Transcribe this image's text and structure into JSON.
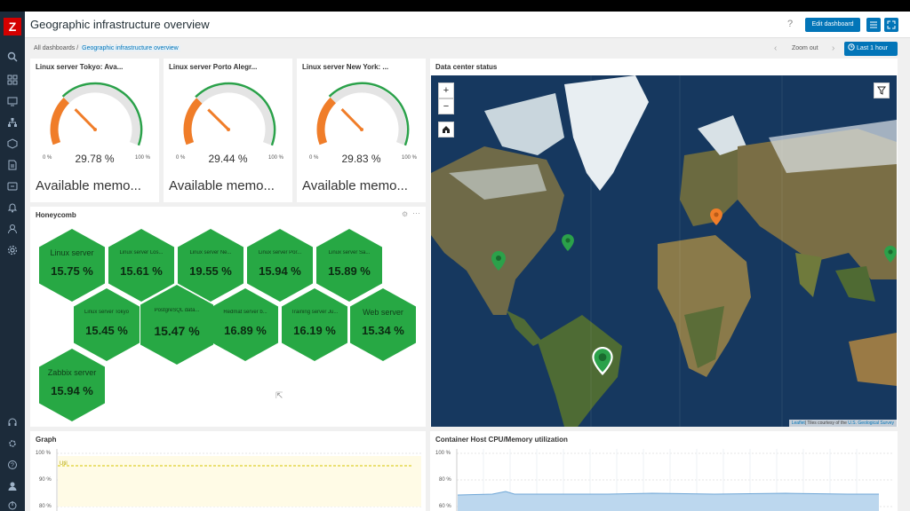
{
  "header": {
    "title": "Geographic infrastructure overview",
    "help": "?",
    "edit_label": "Edit dashboard"
  },
  "breadcrumb": {
    "root": "All dashboards",
    "separator": "/",
    "current": "Geographic infrastructure overview"
  },
  "time_controls": {
    "zoom_out": "Zoom out",
    "range": "Last 1 hour"
  },
  "gauges": [
    {
      "title": "Linux server Tokyo: Ava...",
      "value": "29.78 %",
      "fraction": 0.2978,
      "min": "0 %",
      "max": "100 %",
      "desc": "Available memo..."
    },
    {
      "title": "Linux server Porto Alegr...",
      "value": "29.44 %",
      "fraction": 0.2944,
      "min": "0 %",
      "max": "100 %",
      "desc": "Available memo..."
    },
    {
      "title": "Linux server New York: ...",
      "value": "29.83 %",
      "fraction": 0.2983,
      "min": "0 %",
      "max": "100 %",
      "desc": "Available memo..."
    }
  ],
  "honeycomb": {
    "title": "Honeycomb",
    "cells": [
      {
        "name": "Linux server",
        "value": "15.75 %"
      },
      {
        "name": "Linux server Los...",
        "value": "15.61 %"
      },
      {
        "name": "Linux server Ne...",
        "value": "19.55 %"
      },
      {
        "name": "Linux server Por...",
        "value": "15.94 %"
      },
      {
        "name": "Linux server Sa...",
        "value": "15.89 %"
      },
      {
        "name": "Linux server Tokyo",
        "value": "15.45 %"
      },
      {
        "name": "PostgreSQL data...",
        "value": "15.47 %"
      },
      {
        "name": "Redmat server b...",
        "value": "16.89 %"
      },
      {
        "name": "Training server Ju...",
        "value": "16.19 %"
      },
      {
        "name": "Web server",
        "value": "15.34 %"
      },
      {
        "name": "Zabbix server",
        "value": "15.94 %"
      }
    ]
  },
  "map": {
    "title": "Data center status",
    "zoom_in": "+",
    "zoom_out": "−",
    "attrib_leaflet": "Leaflet",
    "attrib_text": "| Tiles courtesy of the ",
    "attrib_link": "U.S. Geological Survey"
  },
  "graph": {
    "title": "Graph",
    "y_ticks": [
      "100 %",
      "90 %",
      "80 %"
    ],
    "series_label": "Util"
  },
  "container": {
    "title": "Container Host CPU/Memory utilization",
    "y_ticks": [
      "100 %",
      "80 %",
      "60 %"
    ]
  },
  "colors": {
    "accent": "#0275b8",
    "gauge_orange": "#f07d29",
    "gauge_green": "#2ba14a",
    "hex_green": "#27a844",
    "marker_green": "#2ba14a",
    "marker_orange": "#f07d29"
  }
}
